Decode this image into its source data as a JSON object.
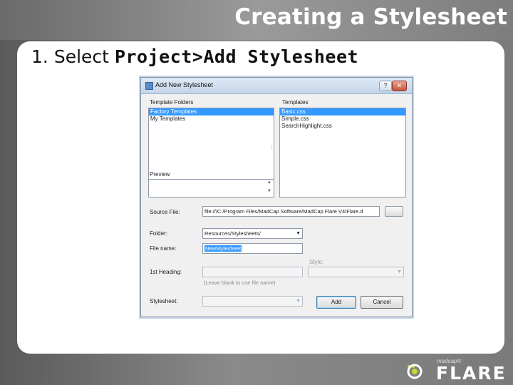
{
  "slide": {
    "title": "Creating a Stylesheet",
    "bullet_number": "1.",
    "bullet_text": "Select",
    "bullet_bold": "Project>Add Stylesheet"
  },
  "dialog": {
    "title": "Add New Stylesheet",
    "help_glyph": "?",
    "close_glyph": "✕",
    "template_folders_label": "Template Folders",
    "template_folders": [
      {
        "label": "Factory Templates",
        "selected": true
      },
      {
        "label": "My Templates",
        "selected": false
      }
    ],
    "templates_label": "Templates",
    "templates": [
      {
        "label": "Basic.css",
        "selected": true
      },
      {
        "label": "Simple.css",
        "selected": false
      },
      {
        "label": "SearchHighlight.css",
        "selected": false
      }
    ],
    "preview_label": "Preview",
    "source_file_label": "Source File:",
    "source_file_value": "file:///C:/Program Files/MadCap Software/MadCap Flare V4/Flare.d",
    "folder_label": "Folder:",
    "folder_value": "Resources/Stylesheets/",
    "file_name_label": "File name:",
    "file_name_value": "NewStylesheet",
    "style_label": "Style:",
    "first_heading_label": "1st Heading:",
    "first_heading_hint": "(Leave blank to use file name)",
    "stylesheet_label": "Stylesheet:",
    "add_button": "Add",
    "cancel_button": "Cancel"
  },
  "logo": {
    "small_text": "madcap®",
    "brand": "FLARE"
  },
  "colors": {
    "selection": "#3399ff",
    "logo_accent": "#c9d92d"
  }
}
